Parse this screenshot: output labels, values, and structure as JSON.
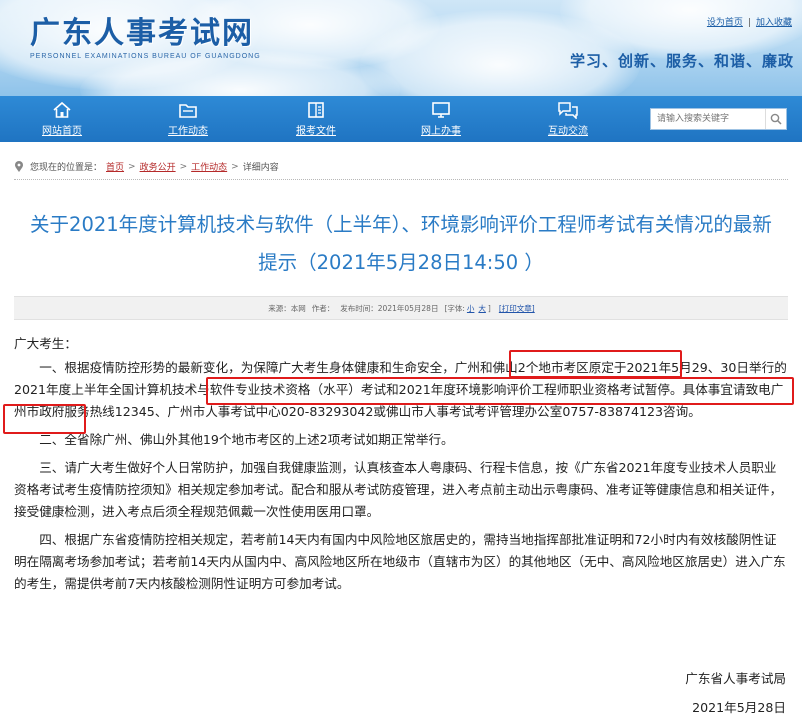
{
  "header": {
    "logo_cn": "广东人事考试网",
    "logo_en": "PERSONNEL EXAMINATIONS BUREAU OF GUANGDONG",
    "top_links": [
      "设为首页",
      "加入收藏"
    ],
    "slogan": "学习、创新、服务、和谐、廉政"
  },
  "nav": {
    "items": [
      {
        "label": "网站首页",
        "icon": "home-icon"
      },
      {
        "label": "工作动态",
        "icon": "folder-icon"
      },
      {
        "label": "报考文件",
        "icon": "book-icon"
      },
      {
        "label": "网上办事",
        "icon": "monitor-icon"
      },
      {
        "label": "互动交流",
        "icon": "chat-icon"
      }
    ],
    "search_placeholder": "请输入搜索关键字"
  },
  "breadcrumb": {
    "prefix": "您现在的位置是：",
    "items": [
      "首页",
      "政务公开",
      "工作动态",
      "详细内容"
    ]
  },
  "article": {
    "title_line1": "关于2021年度计算机技术与软件（上半年）、环境影响评价工程师考试有关情况的最新",
    "title_line2": "提示（2021年5月28日14:50 ）",
    "meta": {
      "source": "来源：本网",
      "author": "作者：",
      "date": "发布时间：2021年05月28日",
      "font_label": "[字体:",
      "font_small": "小",
      "font_large": "大",
      "font_close": "]",
      "print": "[打印文章]"
    },
    "greeting": "广大考生：",
    "p1": "一、根据疫情防控形势的最新变化，为保障广大考生身体健康和生命安全，广州和佛山2个地市考区原定于2021年5月29、30日举行的2021年度上半年全国计算机技术与软件专业技术资格（水平）考试和2021年度环境影响评价工程师职业资格考试暂停。具体事宜请致电广州市政府服务热线12345、广州市人事考试中心020-83293042或佛山市人事考试考评管理办公室0757-83874123咨询。",
    "p2": "二、全省除广州、佛山外其他19个地市考区的上述2项考试如期正常举行。",
    "p3": "三、请广大考生做好个人日常防护，加强自我健康监测，认真核查本人粤康码、行程卡信息，按《广东省2021年度专业技术人员职业资格考试考生疫情防控须知》相关规定参加考试。配合和服从考试防疫管理，进入考点前主动出示粤康码、准考证等健康信息和相关证件，接受健康检测，进入考点后须全程规范佩戴一次性使用医用口罩。",
    "p4": "四、根据广东省疫情防控相关规定，若考前14天内有国内中风险地区旅居史的，需持当地指挥部批准证明和72小时内有效核酸阴性证明在隔离考场参加考试；若考前14天内从国内中、高风险地区所在地级市（直辖市为区）的其他地区（无中、高风险地区旅居史）进入广东的考生，需提供考前7天内核酸检测阴性证明方可参加考试。",
    "signature": "广东省人事考试局",
    "sign_date": "2021年5月28日"
  },
  "colors": {
    "nav_blue": "#1f74c2",
    "title_blue": "#2a7bc5",
    "highlight_red": "#e01b1b"
  }
}
